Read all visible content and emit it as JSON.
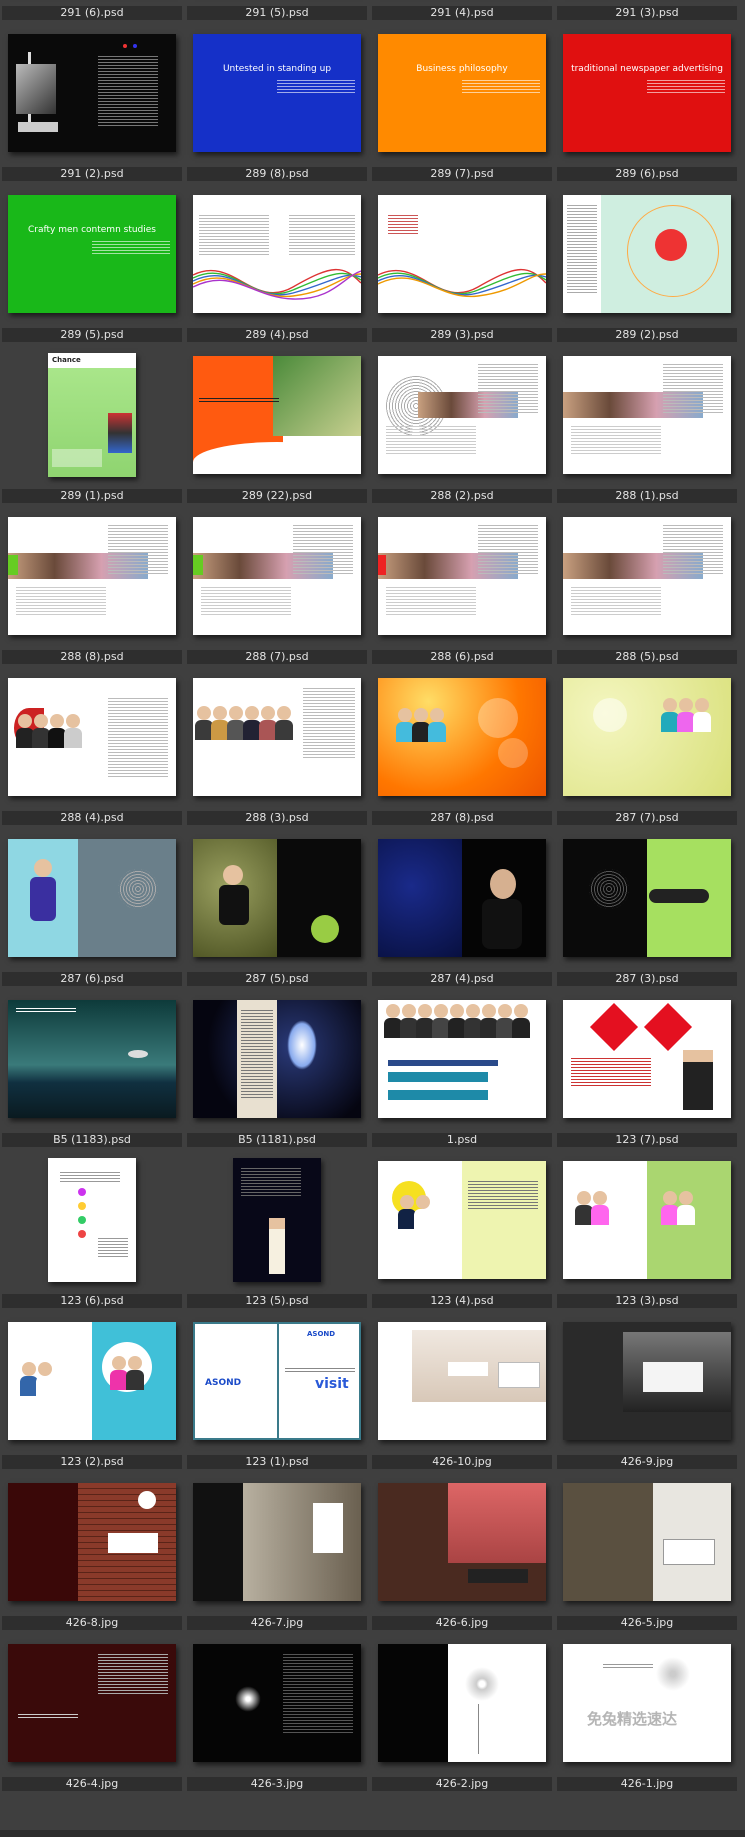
{
  "grid": {
    "columns": 4,
    "items": [
      {
        "label": "291 (6).psd",
        "kind": "cutoff"
      },
      {
        "label": "291 (5).psd",
        "kind": "cutoff"
      },
      {
        "label": "291 (4).psd",
        "kind": "cutoff"
      },
      {
        "label": "291 (3).psd",
        "kind": "cutoff"
      },
      {
        "label": "291 (2).psd",
        "kind": "dark-ship"
      },
      {
        "label": "289 (8).psd",
        "kind": "solid",
        "color": "#1530c8",
        "caption": "Untested in standing up"
      },
      {
        "label": "289 (7).psd",
        "kind": "solid",
        "color": "#ff8a00",
        "caption": "Business    philosophy"
      },
      {
        "label": "289 (6).psd",
        "kind": "solid",
        "color": "#e01010",
        "caption": "traditional newspaper advertising"
      },
      {
        "label": "289 (5).psd",
        "kind": "solid",
        "color": "#19b819",
        "caption": "Crafty men contemn studies"
      },
      {
        "label": "289 (4).psd",
        "kind": "white-waves"
      },
      {
        "label": "289 (3).psd",
        "kind": "white-waves-light"
      },
      {
        "label": "289 (2).psd",
        "kind": "mint-circle"
      },
      {
        "label": "289 (1).psd",
        "kind": "portrait-green",
        "title": "Chance"
      },
      {
        "label": "289 (22).psd",
        "kind": "orange-photo"
      },
      {
        "label": "288 (2).psd",
        "kind": "white-band"
      },
      {
        "label": "288 (1).psd",
        "kind": "white-band-2"
      },
      {
        "label": "288 (8).psd",
        "kind": "white-band-3"
      },
      {
        "label": "288 (7).psd",
        "kind": "white-band-4"
      },
      {
        "label": "288 (6).psd",
        "kind": "white-band-5"
      },
      {
        "label": "288 (5).psd",
        "kind": "white-band-6"
      },
      {
        "label": "288 (4).psd",
        "kind": "white-people"
      },
      {
        "label": "288 (3).psd",
        "kind": "white-people-2"
      },
      {
        "label": "287 (8).psd",
        "kind": "orange-bokeh"
      },
      {
        "label": "287 (7).psd",
        "kind": "yellow-girls"
      },
      {
        "label": "287 (6).psd",
        "kind": "teal-split"
      },
      {
        "label": "287 (5).psd",
        "kind": "olive-black"
      },
      {
        "label": "287 (4).psd",
        "kind": "navy-black"
      },
      {
        "label": "287 (3).psd",
        "kind": "black-lime"
      },
      {
        "label": "B5 (1183).psd",
        "kind": "sea"
      },
      {
        "label": "B5 (1181).psd",
        "kind": "dark-octopus"
      },
      {
        "label": "1.psd",
        "kind": "business-team"
      },
      {
        "label": "123 (7).psd",
        "kind": "red-diamonds"
      },
      {
        "label": "123 (6).psd",
        "kind": "portrait-white"
      },
      {
        "label": "123 (5).psd",
        "kind": "portrait-black"
      },
      {
        "label": "123 (4).psd",
        "kind": "white-yellow"
      },
      {
        "label": "123 (3).psd",
        "kind": "white-green"
      },
      {
        "label": "123 (2).psd",
        "kind": "white-cyan"
      },
      {
        "label": "123 (1).psd",
        "kind": "asond",
        "brand": "ASOND",
        "word": "visit"
      },
      {
        "label": "426-10.jpg",
        "kind": "room-white"
      },
      {
        "label": "426-9.jpg",
        "kind": "room-dark"
      },
      {
        "label": "426-8.jpg",
        "kind": "room-brick"
      },
      {
        "label": "426-7.jpg",
        "kind": "room-black"
      },
      {
        "label": "426-6.jpg",
        "kind": "room-brown"
      },
      {
        "label": "426-5.jpg",
        "kind": "room-olive"
      },
      {
        "label": "426-4.jpg",
        "kind": "maroon"
      },
      {
        "label": "426-3.jpg",
        "kind": "black-dandelion"
      },
      {
        "label": "426-2.jpg",
        "kind": "black-white-dandelion"
      },
      {
        "label": "426-1.jpg",
        "kind": "white-watermark",
        "watermark": "免兔精选速达"
      }
    ]
  }
}
